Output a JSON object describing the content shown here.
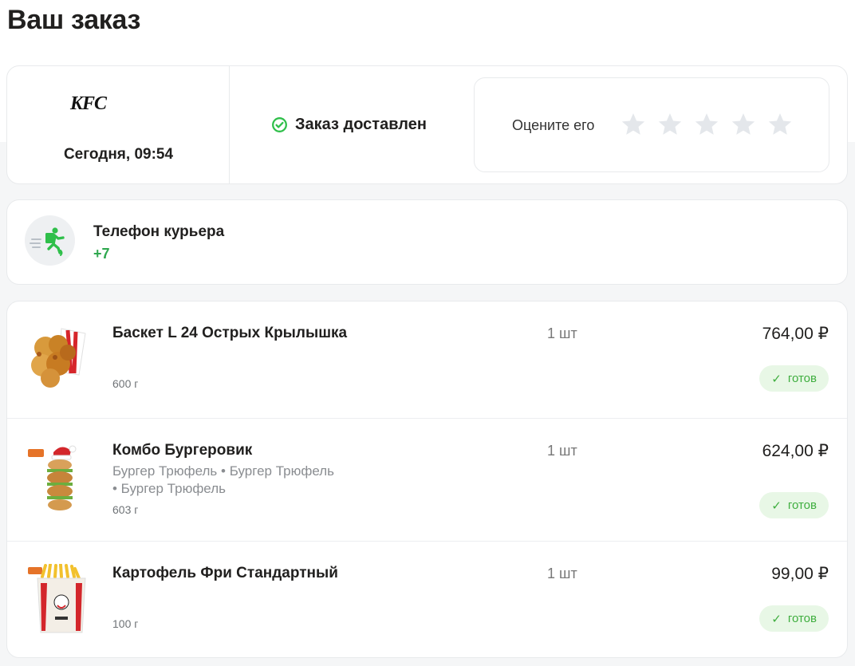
{
  "page_title": "Ваш заказ",
  "order": {
    "restaurant_logo": "KFC",
    "time": "Сегодня, 09:54",
    "status": "Заказ доставлен",
    "rating_label": "Оцените его",
    "rating_stars": 5,
    "colors": {
      "status_green": "#2fbf4a",
      "star_empty": "#e4e7eb"
    }
  },
  "courier": {
    "label": "Телефон курьера",
    "phone": "+7",
    "icon": "courier-running-icon"
  },
  "items": [
    {
      "name": "Баскет L 24 Острых Крылышка",
      "options": [],
      "weight": "600 г",
      "qty": "1 шт",
      "price": "764,00 ₽",
      "status": "готов"
    },
    {
      "name": "Комбо Бургеровик",
      "options": [
        "Бургер Трюфель",
        "Бургер Трюфель",
        "Бургер Трюфель"
      ],
      "option_line1": "Бургер Трюфель  •  Бургер Трюфель",
      "option_line2": "•  Бургер Трюфель",
      "weight": "603 г",
      "qty": "1 шт",
      "price": "624,00 ₽",
      "status": "готов"
    },
    {
      "name": "Картофель Фри Стандартный",
      "options": [],
      "weight": "100 г",
      "qty": "1 шт",
      "price": "99,00 ₽",
      "status": "готов"
    }
  ]
}
